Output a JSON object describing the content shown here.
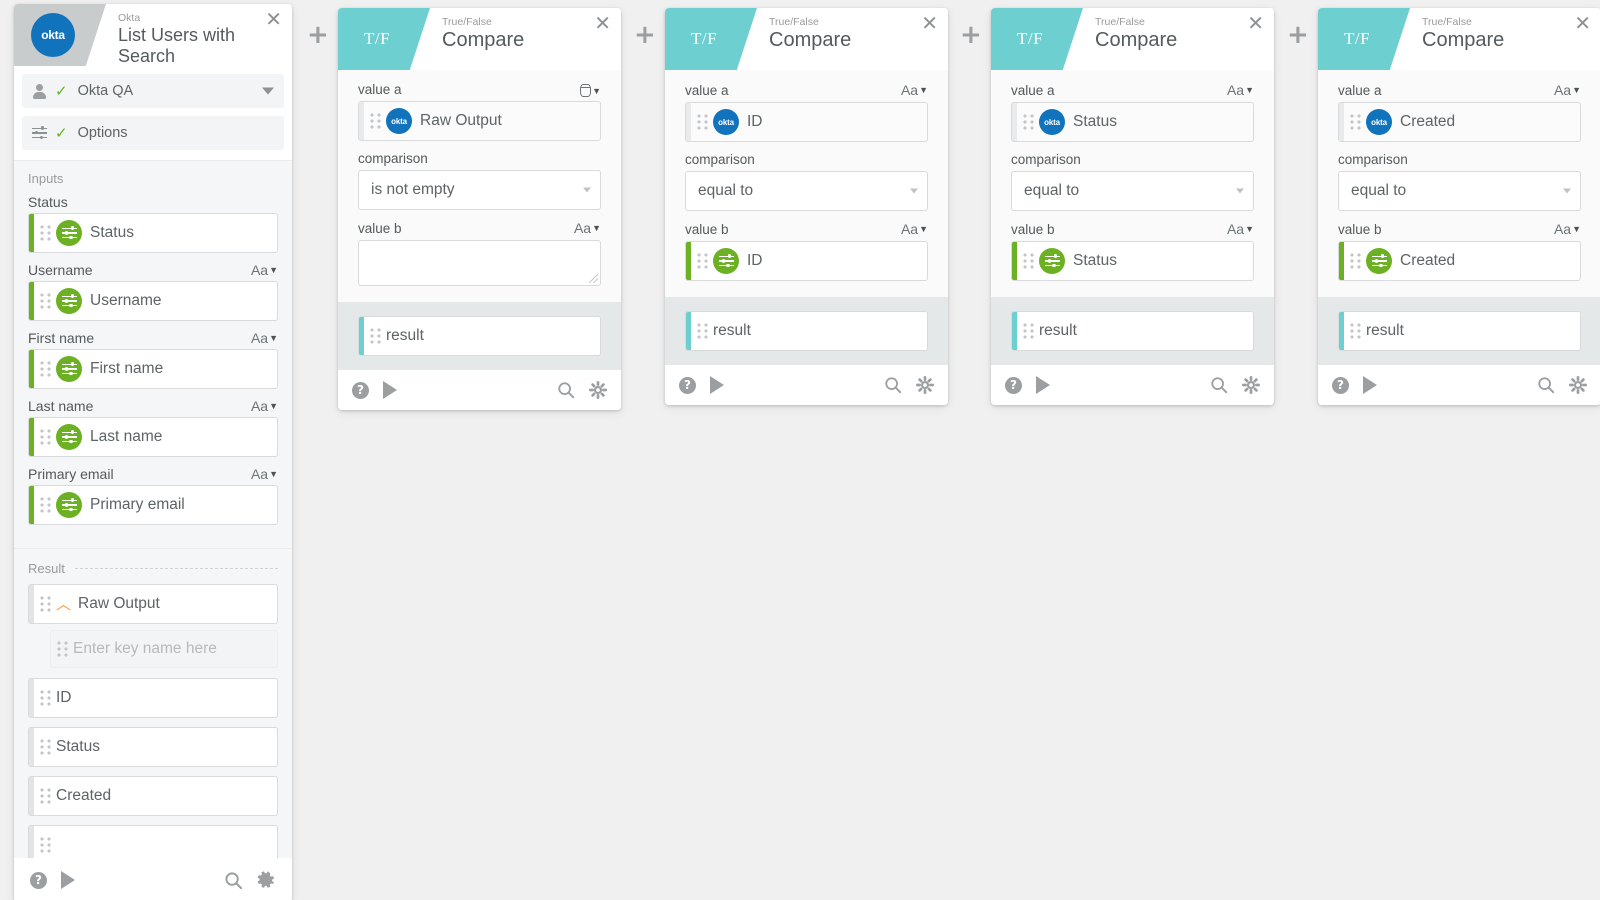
{
  "colors": {
    "teal": "#6ecfd0",
    "green": "#6cb023",
    "okta_blue": "#1273bd",
    "orange": "#f0a03c",
    "canvas": "#f0f0f0"
  },
  "sidebar": {
    "header": {
      "subtitle": "Okta",
      "title": "List Users with Search",
      "logo_label": "okta",
      "close_label": "✕"
    },
    "rows": [
      {
        "label": "Okta QA",
        "icon": "person-icon",
        "check": "✓",
        "has_dropdown": true
      },
      {
        "label": "Options",
        "icon": "sliders-icon",
        "check": "✓",
        "has_dropdown": false
      }
    ],
    "inputs_caption": "Inputs",
    "inputs": [
      {
        "label": "Status",
        "value": "Status",
        "type_toggle": ""
      },
      {
        "label": "Username",
        "value": "Username",
        "type_toggle": "Aa"
      },
      {
        "label": "First name",
        "value": "First name",
        "type_toggle": "Aa"
      },
      {
        "label": "Last name",
        "value": "Last name",
        "type_toggle": "Aa"
      },
      {
        "label": "Primary email",
        "value": "Primary email",
        "type_toggle": "Aa"
      }
    ],
    "result_caption": "Result",
    "results": [
      {
        "label": "Raw Output",
        "icon": "chevron-up-icon"
      },
      {
        "label": "ID",
        "icon": ""
      },
      {
        "label": "Status",
        "icon": ""
      },
      {
        "label": "Created",
        "icon": ""
      }
    ],
    "result_key_placeholder": "Enter key name here",
    "footer": {
      "help": "?",
      "play": "play-icon",
      "search": "search-icon",
      "settings": "gear-icon"
    }
  },
  "add_buttons": [
    {
      "label": "+"
    },
    {
      "label": "+"
    },
    {
      "label": "+"
    },
    {
      "label": "+"
    }
  ],
  "cards": [
    {
      "header": {
        "glyph": "T/F",
        "subtitle": "True/False",
        "title": "Compare",
        "close_label": "✕"
      },
      "value_a": {
        "label": "value a",
        "type_toggle": "cyl",
        "token": "Raw Output",
        "token_icon": "okta-icon",
        "accent": "none"
      },
      "comparison": {
        "label": "comparison",
        "value": "is not empty"
      },
      "value_b": {
        "label": "value b",
        "type_toggle": "Aa",
        "token": "",
        "kind": "textarea"
      },
      "result": {
        "token": "result",
        "accent": "teal"
      },
      "footer": {
        "help": "?",
        "play": "play-icon",
        "search": "search-icon",
        "settings": "gear-icon"
      }
    },
    {
      "header": {
        "glyph": "T/F",
        "subtitle": "True/False",
        "title": "Compare",
        "close_label": "✕"
      },
      "value_a": {
        "label": "value a",
        "type_toggle": "Aa",
        "token": "ID",
        "token_icon": "okta-icon",
        "accent": "none"
      },
      "comparison": {
        "label": "comparison",
        "value": "equal to"
      },
      "value_b": {
        "label": "value b",
        "type_toggle": "Aa",
        "token": "ID",
        "token_icon": "sliders-icon",
        "kind": "pill",
        "accent": "green"
      },
      "result": {
        "token": "result",
        "accent": "teal"
      },
      "footer": {
        "help": "?",
        "play": "play-icon",
        "search": "search-icon",
        "settings": "gear-icon"
      }
    },
    {
      "header": {
        "glyph": "T/F",
        "subtitle": "True/False",
        "title": "Compare",
        "close_label": "✕"
      },
      "value_a": {
        "label": "value a",
        "type_toggle": "Aa",
        "token": "Status",
        "token_icon": "okta-icon",
        "accent": "none"
      },
      "comparison": {
        "label": "comparison",
        "value": "equal to"
      },
      "value_b": {
        "label": "value b",
        "type_toggle": "Aa",
        "token": "Status",
        "token_icon": "sliders-icon",
        "kind": "pill",
        "accent": "green"
      },
      "result": {
        "token": "result",
        "accent": "teal"
      },
      "footer": {
        "help": "?",
        "play": "play-icon",
        "search": "search-icon",
        "settings": "gear-icon"
      }
    },
    {
      "header": {
        "glyph": "T/F",
        "subtitle": "True/False",
        "title": "Compare",
        "close_label": "✕"
      },
      "value_a": {
        "label": "value a",
        "type_toggle": "Aa",
        "token": "Created",
        "token_icon": "okta-icon",
        "accent": "none"
      },
      "comparison": {
        "label": "comparison",
        "value": "equal to"
      },
      "value_b": {
        "label": "value b",
        "type_toggle": "Aa",
        "token": "Created",
        "token_icon": "sliders-icon",
        "kind": "pill",
        "accent": "green"
      },
      "result": {
        "token": "result",
        "accent": "teal"
      },
      "footer": {
        "help": "?",
        "play": "play-icon",
        "search": "search-icon",
        "settings": "gear-icon"
      }
    }
  ]
}
